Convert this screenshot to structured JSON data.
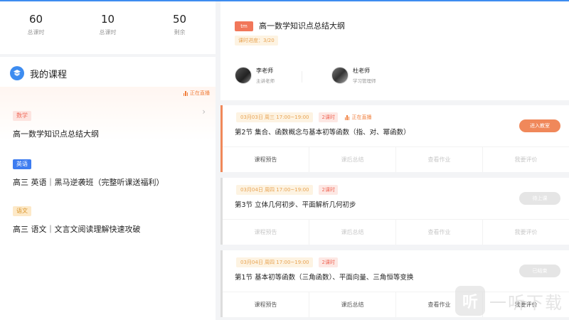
{
  "stats": [
    {
      "value": "60",
      "label": "总课时"
    },
    {
      "value": "10",
      "label": "总课时"
    },
    {
      "value": "50",
      "label": "剩余"
    }
  ],
  "courses": {
    "title": "我的课程",
    "live_label": "正在直播",
    "items": [
      {
        "tag": "数学",
        "name": "高一数学知识点总结大纲"
      },
      {
        "tag": "英语",
        "name": "高三 英语｜黑马逆袭班（完整听课送福利）"
      },
      {
        "tag": "语文",
        "name": "高三 语文｜文言文阅读理解快速攻破"
      }
    ]
  },
  "class_info": {
    "badge": "tm",
    "title": "高一数学知识点总结大纲",
    "progress": "课时进度：3/20",
    "teachers": [
      {
        "name": "李老师",
        "role": "主讲老师"
      },
      {
        "name": "杜老师",
        "role": "学习管理师"
      }
    ]
  },
  "lessons": [
    {
      "date": "03月03日  周三  17:00~19:00",
      "duration": "2课时",
      "live": "正在直播",
      "title": "第2节 集合、函数概念与基本初等函数（指、对、幂函数）",
      "button": "进入教室",
      "actions": [
        "课程预告",
        "课后总结",
        "查看作业",
        "我要评价"
      ]
    },
    {
      "date": "03月04日  周四  17:00~19:00",
      "duration": "2课时",
      "title": "第3节 立体几何初步、平面解析几何初步",
      "button": "待上课",
      "actions": [
        "课程预告",
        "课后总结",
        "查看作业",
        "我要评价"
      ]
    },
    {
      "date": "03月04日  周四  17:00~19:00",
      "duration": "2课时",
      "title": "第1节 基本初等函数（三角函数）、平面向量、三角恒等变换",
      "button": "已结束",
      "actions": [
        "课程预告",
        "课后总结",
        "查看作业",
        "我要评价"
      ]
    }
  ],
  "watermark": {
    "logo": "听",
    "text": "一听下载"
  },
  "colors": {
    "accent": "#3d8cf0",
    "live": "#f07d3a",
    "enter_button": "#f0885a"
  }
}
